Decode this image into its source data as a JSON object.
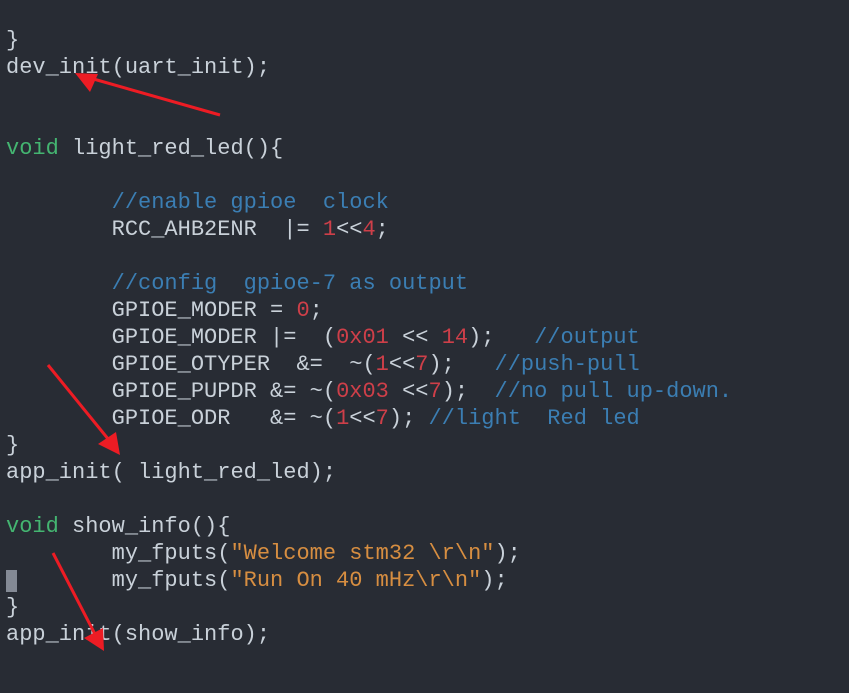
{
  "code": {
    "l1": "}",
    "l2a": "dev_init",
    "l2b": "(uart_init);",
    "l3": "",
    "l4": "",
    "l5a": "void",
    "l5b": " ",
    "l5c": "light_red_led",
    "l5d": "(){",
    "l6": "",
    "l7": "        //enable gpioe  clock",
    "l8a": "        RCC_AHB2ENR  |= ",
    "l8b": "1",
    "l8c": "<<",
    "l8d": "4",
    "l8e": ";",
    "l9": "",
    "l10": "        //config  gpioe-7 as output",
    "l11a": "        GPIOE_MODER = ",
    "l11b": "0",
    "l11c": ";",
    "l12a": "        GPIOE_MODER |=  (",
    "l12b": "0x01",
    "l12c": " << ",
    "l12d": "14",
    "l12e": ");   ",
    "l12f": "//output",
    "l13a": "        GPIOE_OTYPER  &=  ~(",
    "l13b": "1",
    "l13c": "<<",
    "l13d": "7",
    "l13e": ");   ",
    "l13f": "//push-pull",
    "l14a": "        GPIOE_PUPDR &= ~(",
    "l14b": "0x03",
    "l14c": " <<",
    "l14d": "7",
    "l14e": ");  ",
    "l14f": "//no pull up-down.",
    "l15a": "        GPIOE_ODR   &= ~(",
    "l15b": "1",
    "l15c": "<<",
    "l15d": "7",
    "l15e": "); ",
    "l15f": "//light  Red led",
    "l16": "}",
    "l17a": "app_init",
    "l17b": "( light_red_led);",
    "l18": "",
    "l19a": "void",
    "l19b": " ",
    "l19c": "show_info",
    "l19d": "(){",
    "l20a": "        my_fputs(",
    "l20b": "\"Welcome stm32 \\r\\n\"",
    "l20c": ");",
    "l21a": "        my_fputs(",
    "l21b": "\"Run On 40 mHz\\r\\n\"",
    "l21c": ");",
    "l22": "}",
    "l23a": "app_init",
    "l23b": "(show_info);"
  }
}
